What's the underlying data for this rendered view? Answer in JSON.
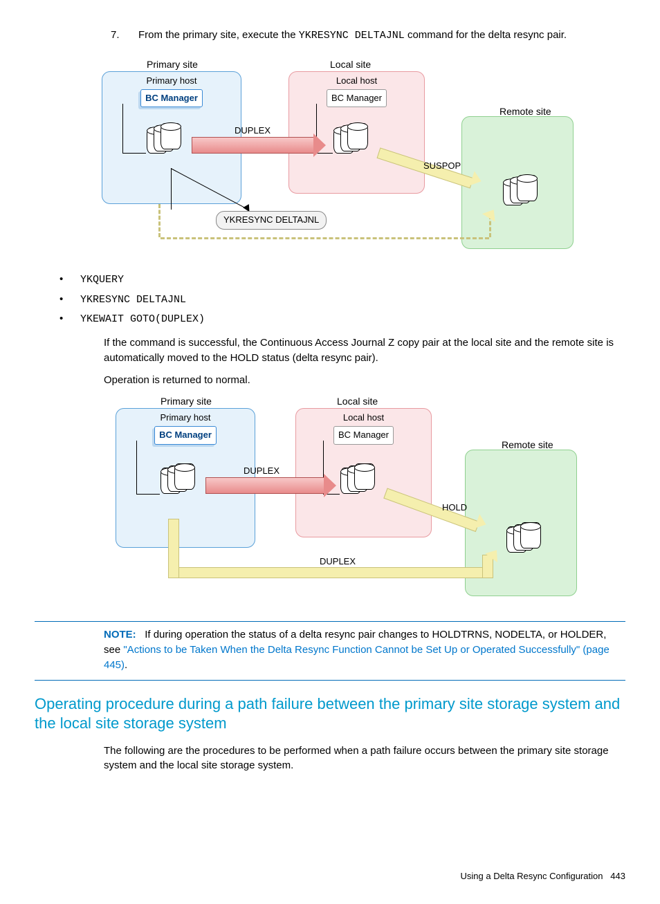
{
  "step": {
    "number": "7.",
    "text_a": "From the primary site, execute the ",
    "cmd": "YKRESYNC DELTAJNL",
    "text_b": " command for the delta resync pair."
  },
  "diagram1": {
    "primary_site": "Primary site",
    "primary_host": "Primary host",
    "bc_manager": "BC Manager",
    "local_site": "Local site",
    "local_host": "Local host",
    "remote_site": "Remote site",
    "duplex": "DUPLEX",
    "suspop": "SUSPOP",
    "cmd": "YKRESYNC DELTAJNL"
  },
  "commands": [
    "YKQUERY",
    "YKRESYNC DELTAJNL",
    "YKEWAIT GOTO(DUPLEX)"
  ],
  "result_para": "If the command is successful, the Continuous Access Journal Z copy pair at the local site and the remote site is automatically moved to the HOLD status (delta resync pair).",
  "normal_para": "Operation is returned to normal.",
  "diagram2": {
    "primary_site": "Primary site",
    "primary_host": "Primary host",
    "bc_manager": "BC Manager",
    "local_site": "Local site",
    "local_host": "Local host",
    "remote_site": "Remote site",
    "duplex": "DUPLEX",
    "hold": "HOLD",
    "duplex2": "DUPLEX"
  },
  "note": {
    "label": "NOTE:",
    "text": "If during operation the status of a delta resync pair changes to HOLDTRNS, NODELTA, or HOLDER, see ",
    "link": "\"Actions to be Taken When the Delta Resync Function Cannot be Set Up or Operated Successfully\" (page 445)",
    "period": "."
  },
  "heading": "Operating procedure during a path failure between the primary site storage system and the local site storage system",
  "body": "The following are the procedures to be performed when a path failure occurs between the primary site storage system and the local site storage system.",
  "footer": {
    "text": "Using a Delta Resync Configuration",
    "page": "443"
  }
}
